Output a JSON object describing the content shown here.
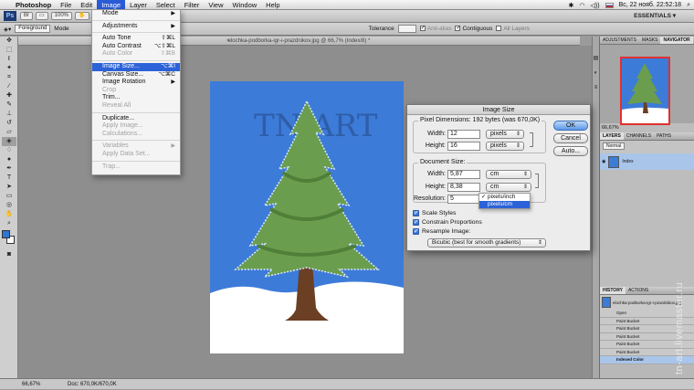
{
  "menubar": {
    "apple": "",
    "app_name": "Photoshop",
    "items": [
      "File",
      "Edit",
      "Image",
      "Layer",
      "Select",
      "Filter",
      "View",
      "Window",
      "Help"
    ],
    "active_item": "Image",
    "clock": "Вс, 22 нояб.  22:52:18"
  },
  "appbar": {
    "logo": "Ps",
    "zoom": "100%",
    "workspace": "ESSENTIALS ▾"
  },
  "options": {
    "foreground": "Foreground",
    "mode": "Mode",
    "tolerance": "Tolerance",
    "anti_alias": "Anti-alias",
    "contiguous": "Contiguous",
    "all_layers": "All Layers"
  },
  "document": {
    "tab_title": "elochka-podborka-igr-i-prazdnikov.jpg @ 66,7% (Index/8) *",
    "zoom_status": "66,67%",
    "doc_status": "Doc: 670,0K/670,0K"
  },
  "image_menu": {
    "items": [
      {
        "label": "Mode",
        "submenu": true
      },
      {
        "sep": true
      },
      {
        "label": "Adjustments",
        "submenu": true
      },
      {
        "sep": true
      },
      {
        "label": "Auto Tone",
        "shortcut": "⇧⌘L"
      },
      {
        "label": "Auto Contrast",
        "shortcut": "⌥⇧⌘L"
      },
      {
        "label": "Auto Color",
        "shortcut": "⇧⌘B",
        "disabled": true
      },
      {
        "sep": true
      },
      {
        "label": "Image Size...",
        "shortcut": "⌥⌘I",
        "highlighted": true
      },
      {
        "label": "Canvas Size...",
        "shortcut": "⌥⌘C"
      },
      {
        "label": "Image Rotation",
        "submenu": true
      },
      {
        "label": "Crop",
        "disabled": true
      },
      {
        "label": "Trim..."
      },
      {
        "label": "Reveal All",
        "disabled": true
      },
      {
        "sep": true
      },
      {
        "label": "Duplicate..."
      },
      {
        "label": "Apply Image...",
        "disabled": true
      },
      {
        "label": "Calculations...",
        "disabled": true
      },
      {
        "sep": true
      },
      {
        "label": "Variables",
        "submenu": true,
        "disabled": true
      },
      {
        "label": "Apply Data Set...",
        "disabled": true
      },
      {
        "sep": true
      },
      {
        "label": "Trap...",
        "disabled": true
      }
    ]
  },
  "dialog": {
    "title": "Image Size",
    "pixel_dimensions": "Pixel Dimensions:  192 bytes (was 670,0K)",
    "width_label": "Width:",
    "height_label": "Height:",
    "px_width": "12",
    "px_height": "16",
    "px_unit": "pixels",
    "doc_size": "Document Size:",
    "doc_width": "5,87",
    "doc_height": "8,38",
    "doc_unit": "cm",
    "resolution_label": "Resolution:",
    "resolution": "5",
    "res_options": [
      "pixels/inch",
      "pixels/cm"
    ],
    "res_checked": "pixels/inch",
    "res_highlight": "pixels/cm",
    "scale_styles": "Scale Styles",
    "constrain": "Constrain Proportions",
    "resample": "Resample Image:",
    "method": "Bicubic (best for smooth gradients)",
    "ok": "OK",
    "cancel": "Cancel",
    "auto": "Auto..."
  },
  "canvas": {
    "watermark": "TN  ART"
  },
  "panels": {
    "top_tabs": [
      "ADJUSTMENTS",
      "MASKS",
      "NAVIGATOR"
    ],
    "nav_zoom": "66,67%",
    "layer_tabs": [
      "LAYERS",
      "CHANNELS",
      "PATHS"
    ],
    "blend": "Normal",
    "layer_name": "Index",
    "history_tabs": [
      "HISTORY",
      "ACTIONS"
    ],
    "history_file": "elochka-podborka-igr-i-prazdnikov.jpg",
    "history_items": [
      "Open",
      "Paint Bucket",
      "Paint Bucket",
      "Paint Bucket",
      "Paint Bucket",
      "Paint Bucket",
      "Indexed Color"
    ]
  },
  "watermark_side": "tn-art.livemaster.ru",
  "colors": {
    "menu_highlight": "#2c62d8",
    "canvas_blue": "#3d7bd8",
    "tree_green": "#6a9e4e",
    "trunk": "#6b3f23",
    "snow": "#ffffff"
  }
}
